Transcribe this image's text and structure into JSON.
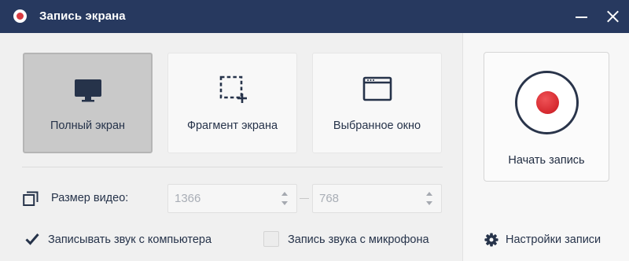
{
  "window": {
    "title": "Запись экрана",
    "icon": "record-icon"
  },
  "modes": [
    {
      "label": "Полный экран",
      "icon": "monitor-icon",
      "selected": true
    },
    {
      "label": "Фрагмент экрана",
      "icon": "region-select-icon",
      "selected": false
    },
    {
      "label": "Выбранное окно",
      "icon": "window-icon",
      "selected": false
    }
  ],
  "video_size": {
    "label": "Размер видео:",
    "width": "1366",
    "height": "768"
  },
  "options": {
    "record_system_audio": {
      "label": "Записывать звук с компьютера",
      "checked": true
    },
    "record_mic_audio": {
      "label": "Запись звука с микрофона",
      "checked": false
    }
  },
  "record_button": {
    "label": "Начать запись"
  },
  "settings": {
    "label": "Настройки записи",
    "icon": "gear-icon"
  },
  "colors": {
    "titlebar": "#27395f",
    "record": "#d72b31",
    "selected_card": "#c9c9c9"
  }
}
